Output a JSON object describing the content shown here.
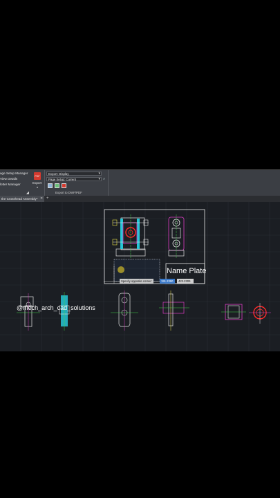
{
  "ribbon": {
    "page_setup_manager": "age Setup Manager",
    "view_details": "View Details",
    "plotter_manager": "lotter Manager",
    "export_label": "Export",
    "export_display": "Export: Display",
    "page_setup": "Page Setup: Current",
    "panel_title": "Export to DWF/PDF",
    "pdf_icon_text": "PDF"
  },
  "tabs": {
    "active": "the Crosshead Assembly*",
    "add": "+"
  },
  "canvas": {
    "name_plate": "Name Plate",
    "prompt": "Specify opposite corner:",
    "coord_x": "191.2390",
    "coord_y": "422.2309"
  },
  "watermark": "@mech_arch_cad_solutions",
  "colors": {
    "ribbon_bg": "#3b3e44",
    "canvas_bg": "#1b1e23",
    "accent_blue": "#3a79c9",
    "cyan": "#26c6d6",
    "magenta": "#e03cc8",
    "red": "#ff2a2a",
    "green": "#3fd24a",
    "yellow": "#e8e04a"
  }
}
